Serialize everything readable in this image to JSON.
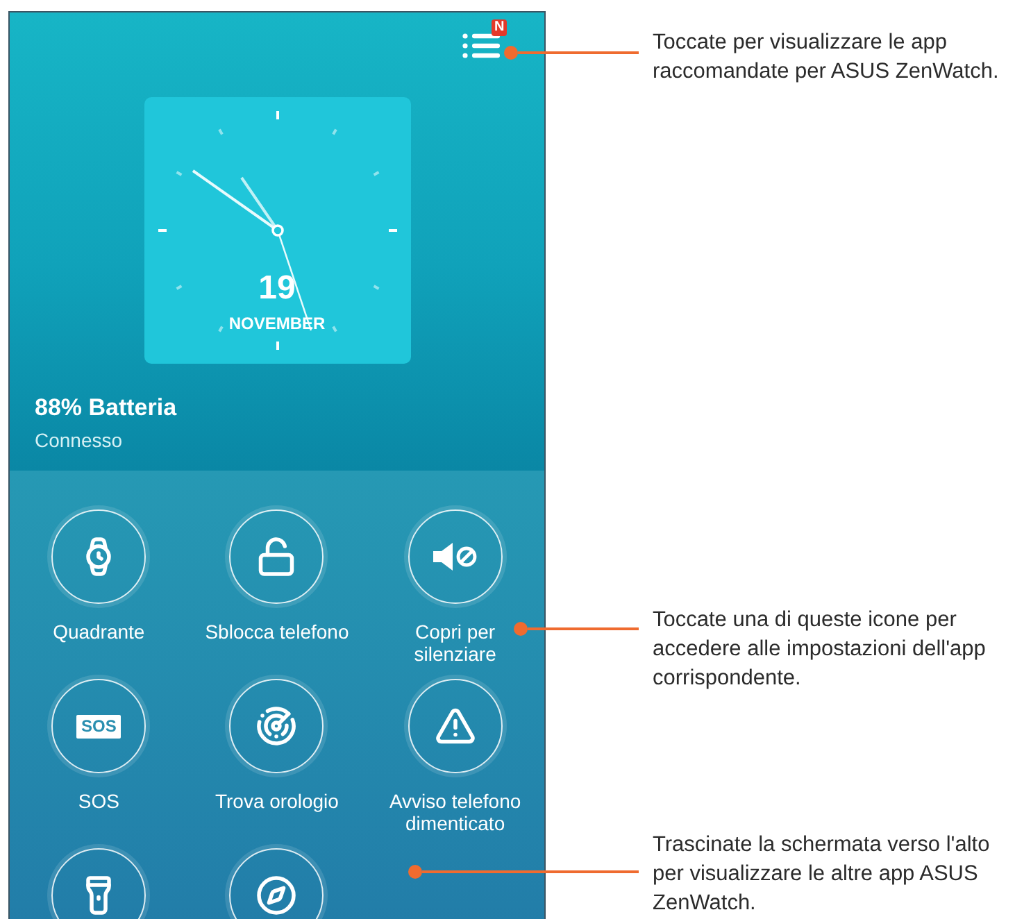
{
  "header": {
    "menu_badge": "N"
  },
  "clock": {
    "day": "19",
    "month": "NOVEMBER"
  },
  "status": {
    "battery": "88% Batteria",
    "connection": "Connesso"
  },
  "apps": [
    {
      "kind": "watch",
      "label": "Quadrante"
    },
    {
      "kind": "unlock",
      "label": "Sblocca telefono"
    },
    {
      "kind": "mute",
      "label": "Copri per silenziare"
    },
    {
      "kind": "sos",
      "label": "SOS",
      "icon_text": "SOS"
    },
    {
      "kind": "radar",
      "label": "Trova orologio"
    },
    {
      "kind": "alert",
      "label": "Avviso telefono dimenticato"
    },
    {
      "kind": "flashlight"
    },
    {
      "kind": "compass"
    }
  ],
  "callouts": [
    {
      "text": "Toccate per visualizzare le app raccomandate per ASUS ZenWatch."
    },
    {
      "text": "Toccate una di queste icone per accedere alle impostazioni dell'app corrispondente."
    },
    {
      "text": "Trascinate la schermata verso l'alto per visualizzare le altre app ASUS ZenWatch."
    }
  ]
}
